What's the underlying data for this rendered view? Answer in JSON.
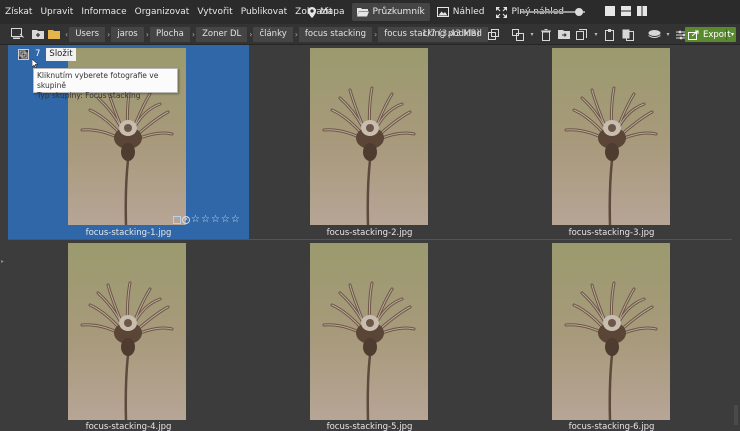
{
  "menu": {
    "items": [
      "Získat",
      "Upravit",
      "Informace",
      "Organizovat",
      "Vytvořit",
      "Publikovat",
      "Zobrazit"
    ]
  },
  "modes": {
    "map": "Mapa",
    "browser": "Průzkumník",
    "preview": "Náhled",
    "fullscreen": "Plný náhled"
  },
  "thumbnail_size_fraction": 0.9,
  "breadcrumb": [
    "Users",
    "jaros",
    "Plocha",
    "Zoner DL",
    "články",
    "focus stacking",
    "focus stacking podklad"
  ],
  "status": {
    "count": "1/7 (3.43 MB)"
  },
  "export_label": "Export",
  "group": {
    "count": "7",
    "label": "Složit",
    "tooltip_line1": "Kliknutím vyberete fotografie ve skupině",
    "tooltip_line2": "Typ skupiny: Focus stacking"
  },
  "files": [
    {
      "name": "focus-stacking-1.jpg",
      "selected": true
    },
    {
      "name": "focus-stacking-2.jpg",
      "selected": false
    },
    {
      "name": "focus-stacking-3.jpg",
      "selected": false
    },
    {
      "name": "focus-stacking-4.jpg",
      "selected": false
    },
    {
      "name": "focus-stacking-5.jpg",
      "selected": false
    },
    {
      "name": "focus-stacking-6.jpg",
      "selected": false
    }
  ],
  "rating": {
    "stars": 0,
    "max": 5
  },
  "colors": {
    "accent_selected": "#2f67a8",
    "export_green": "#5a8a2e",
    "background": "#3c3c3c",
    "menubar": "#2b2b2b"
  }
}
